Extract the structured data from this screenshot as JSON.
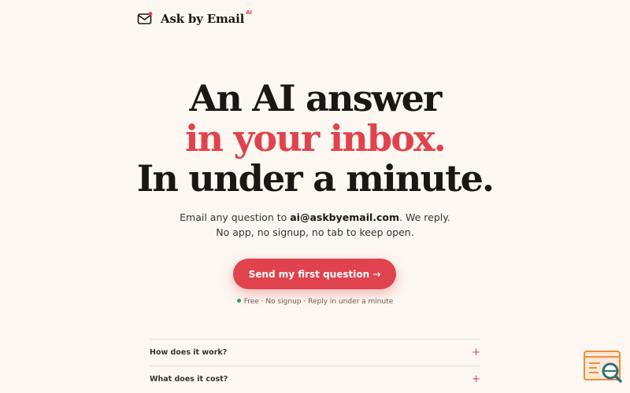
{
  "brand": {
    "name": "Ask by Email",
    "superscript": "AI",
    "icon": "mail-icon",
    "accent_color": "#e0434d"
  },
  "hero": {
    "line1": "An AI answer",
    "line2": "in your inbox.",
    "line3": "In under a minute."
  },
  "subtitle": {
    "prefix": "Email any question to ",
    "email": "ai@askbyemail.com",
    "suffix": ". We reply. No app, no signup, no tab to keep open."
  },
  "cta": {
    "label": "Send my first question →",
    "color": "#e0434d"
  },
  "meta": {
    "text": "Free · No signup · Reply in under a minute",
    "dot_color": "#2e9c5a"
  },
  "faq": {
    "items": [
      {
        "question": "How does it work?",
        "icon": "plus-icon"
      },
      {
        "question": "What does it cost?",
        "icon": "plus-icon"
      }
    ]
  },
  "widget": {
    "icon": "search-document-icon"
  }
}
